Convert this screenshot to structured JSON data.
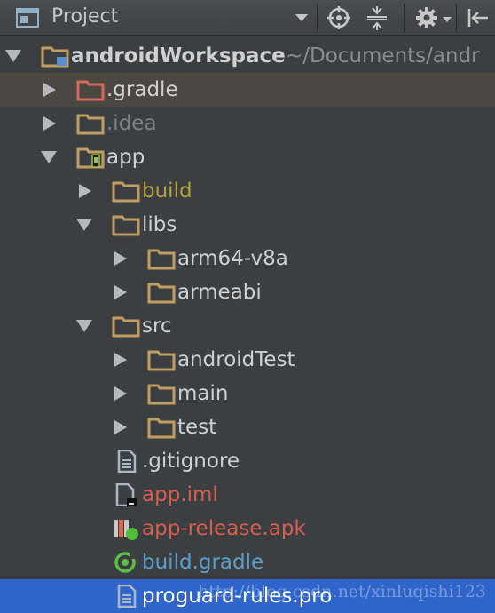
{
  "toolbar": {
    "title": "Project",
    "icons": [
      "project-view-icon",
      "dropdown-icon",
      "locate-icon",
      "collapse-all-icon",
      "gear-icon",
      "hide-panel-icon"
    ]
  },
  "tree": {
    "rows": [
      {
        "label": "androidWorkspace",
        "sub": "~/Documents/andr",
        "color": "#d0d0d0",
        "bold": true,
        "expanded": true,
        "icon": "module-folder"
      },
      {
        "label": ".gradle",
        "color": "#d0d0d0",
        "expanded": false,
        "icon": "folder-excluded"
      },
      {
        "label": ".idea",
        "color": "#7f8183",
        "expanded": false,
        "icon": "folder"
      },
      {
        "label": "app",
        "color": "#d0d0d0",
        "bold": false,
        "expanded": true,
        "icon": "android-module-folder"
      },
      {
        "label": "build",
        "color": "#b4a23a",
        "expanded": false,
        "icon": "folder"
      },
      {
        "label": "libs",
        "color": "#d0d0d0",
        "expanded": true,
        "icon": "folder"
      },
      {
        "label": "arm64-v8a",
        "color": "#d0d0d0",
        "expanded": false,
        "icon": "folder"
      },
      {
        "label": "armeabi",
        "color": "#d0d0d0",
        "expanded": false,
        "icon": "folder"
      },
      {
        "label": "src",
        "color": "#d0d0d0",
        "expanded": true,
        "icon": "folder"
      },
      {
        "label": "androidTest",
        "color": "#d0d0d0",
        "expanded": false,
        "icon": "folder"
      },
      {
        "label": "main",
        "color": "#d0d0d0",
        "expanded": false,
        "icon": "folder"
      },
      {
        "label": "test",
        "color": "#d0d0d0",
        "expanded": false,
        "icon": "folder"
      },
      {
        "label": ".gitignore",
        "color": "#d0d0d0",
        "icon": "text-file"
      },
      {
        "label": "app.iml",
        "color": "#d65e4e",
        "icon": "iml-file"
      },
      {
        "label": "app-release.apk",
        "color": "#d65e4e",
        "icon": "apk-file"
      },
      {
        "label": "build.gradle",
        "color": "#5f9dc9",
        "icon": "gradle-file"
      },
      {
        "label": "proguard-rules.pro",
        "color": "#ffffff",
        "icon": "text-file",
        "selected": true
      }
    ]
  },
  "watermark": "http://blog.csdn.net/xinluqishi123",
  "colors": {
    "background": "#3c3f41",
    "folder": "#c19d62",
    "selection": "#2f65ca",
    "hover": "#4b4842"
  }
}
